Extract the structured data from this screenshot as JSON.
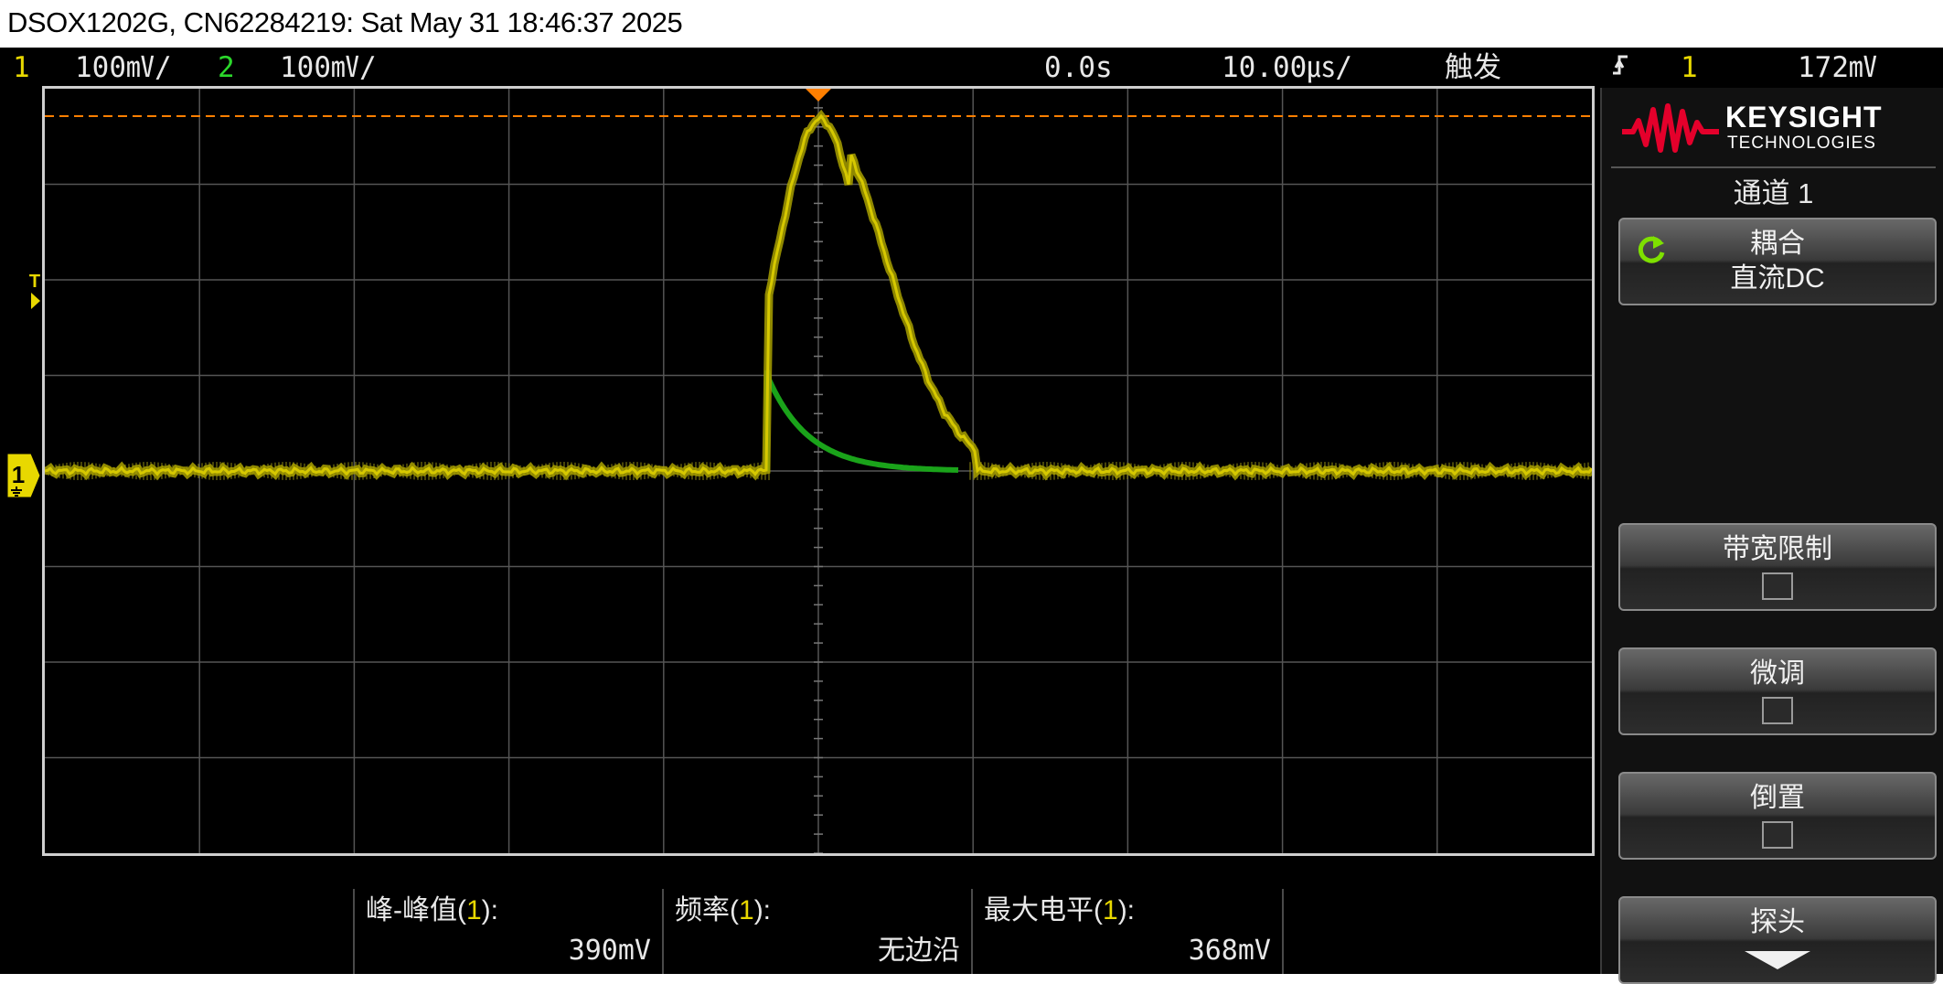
{
  "window_title": "DSOX1202G, CN62284219: Sat May 31 18:46:37 2025",
  "status": {
    "ch1_num": "1",
    "ch1_scale": "100",
    "ch1_unit": "㎷/",
    "ch2_num": "2",
    "ch2_scale": "100",
    "ch2_unit": "㎷/",
    "time_delay": "0.0s",
    "time_scale": "10.00",
    "time_unit": "㎲/",
    "trigger_label": "触发",
    "trigger_edge_icon": "rising-edge-icon",
    "trigger_source": "1",
    "trigger_level": "172",
    "trigger_level_unit": "㎷"
  },
  "markers": {
    "trigger_marker": "T",
    "ch1_marker": "1"
  },
  "colors": {
    "ch1": "#e8d800",
    "ch1_trace": "#a8a000",
    "ch2": "#2bd82b",
    "ch2_trace": "#1aa31a",
    "trigger_line": "#ff7f00",
    "grid": "#555555"
  },
  "panel": {
    "brand": "KEYSIGHT",
    "brand_sub": "TECHNOLOGIES",
    "channel_title": "通道 1",
    "softkeys": [
      {
        "label": "耦合",
        "value": "直流DC",
        "icon": "cycle-icon"
      },
      {
        "label": "带宽限制",
        "value": "",
        "icon": "checkbox-icon",
        "checked": false
      },
      {
        "label": "微调",
        "value": "",
        "icon": "checkbox-icon",
        "checked": false
      },
      {
        "label": "倒置",
        "value": "",
        "icon": "checkbox-icon",
        "checked": false
      },
      {
        "label": "探头",
        "value": "",
        "icon": "down-arrow-icon"
      }
    ]
  },
  "measurements": [
    {
      "label_prefix": "峰-峰值(",
      "ch": "1",
      "label_suffix": "):",
      "value": "390mV"
    },
    {
      "label_prefix": "频率(",
      "ch": "1",
      "label_suffix": "):",
      "value": "无边沿"
    },
    {
      "label_prefix": "最大电平(",
      "ch": "1",
      "label_suffix": "):",
      "value": "368mV"
    }
  ]
}
